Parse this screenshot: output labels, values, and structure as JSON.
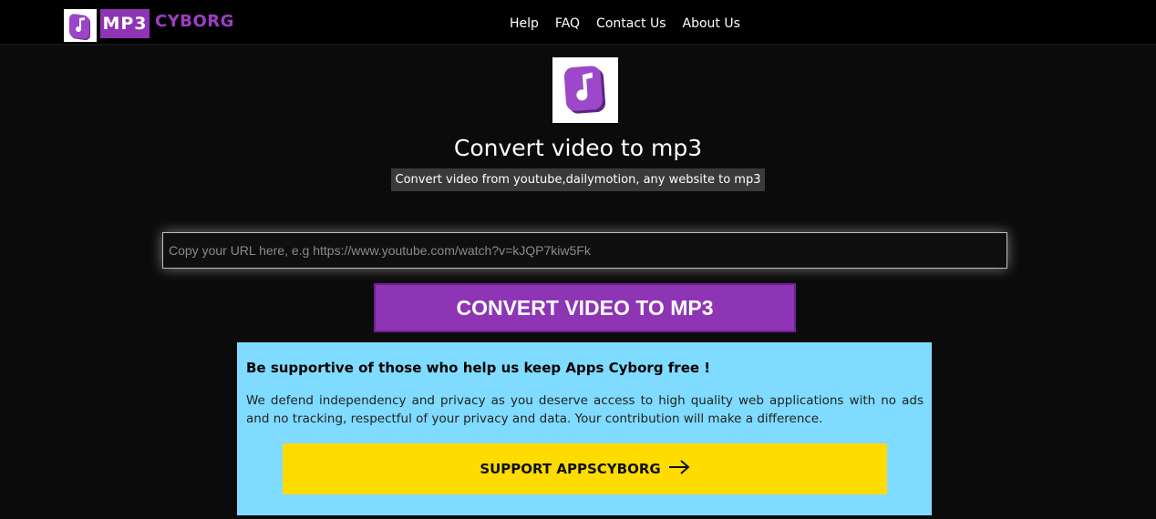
{
  "header": {
    "logo_badge": "MP3",
    "logo_text": "CYBORG",
    "nav": [
      {
        "label": "Help"
      },
      {
        "label": "FAQ"
      },
      {
        "label": "Contact Us"
      },
      {
        "label": "About Us"
      }
    ]
  },
  "hero": {
    "title": "Convert video to mp3",
    "subtitle": "Convert video from youtube,dailymotion, any website to mp3",
    "url_placeholder": "Copy your URL here, e.g https://www.youtube.com/watch?v=kJQP7kiw5Fk",
    "url_value": "",
    "convert_label": "CONVERT VIDEO TO MP3"
  },
  "support": {
    "heading": "Be supportive of those who help us keep Apps Cyborg free !",
    "body": "We defend independency and privacy as you deserve access to high quality web applications with no ads and no tracking, respectful of your privacy and data. Your contribution will make a difference.",
    "button_label": "SUPPORT APPSCYBORG",
    "button_icon": "arrow-right-icon"
  },
  "colors": {
    "brand_purple": "#8e35b5",
    "support_bg": "#7fdbff",
    "support_button": "#ffdc00",
    "page_bg": "#0b0b0b"
  }
}
